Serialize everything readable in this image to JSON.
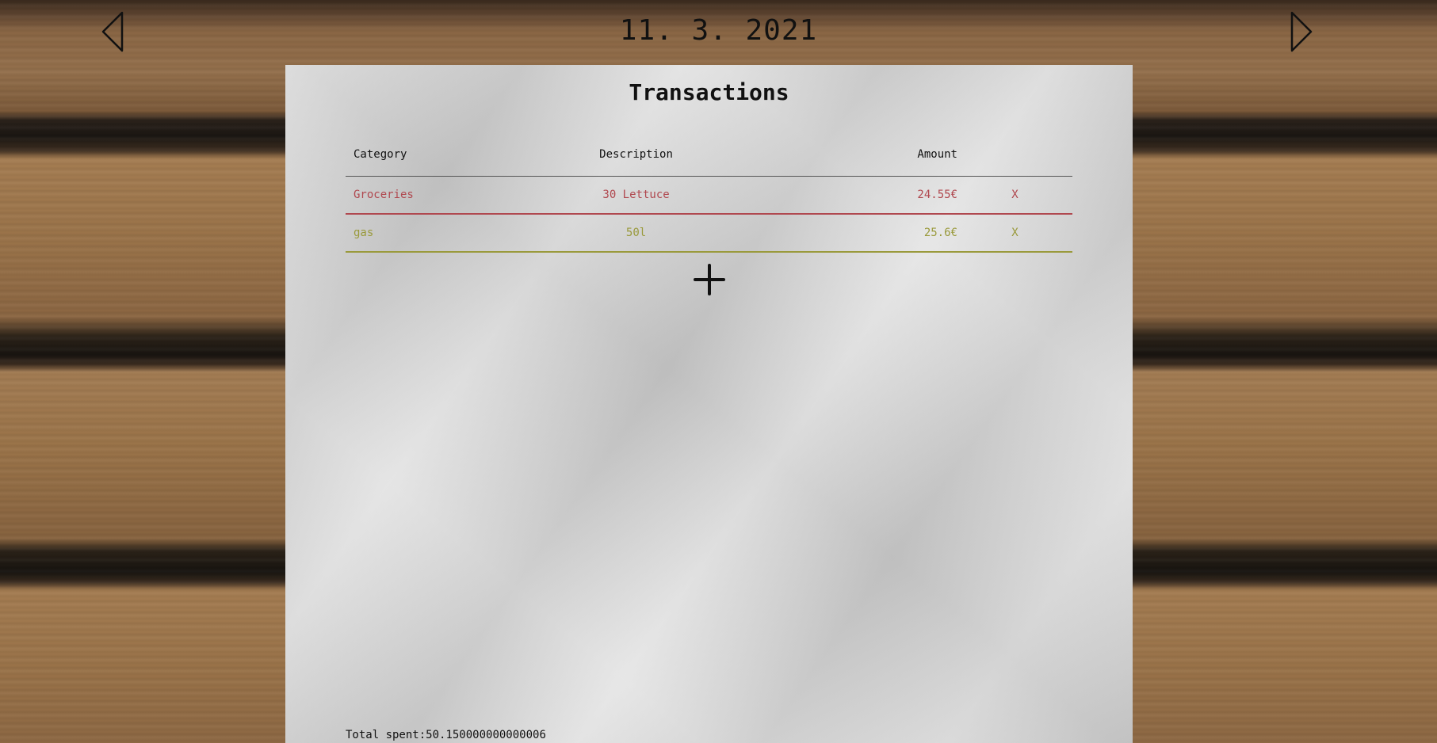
{
  "header": {
    "date": "11. 3. 2021",
    "prev_icon": "triangle-left-outline-icon",
    "next_icon": "triangle-right-outline-icon"
  },
  "paper": {
    "title": "Transactions",
    "columns": {
      "category": "Category",
      "description": "Description",
      "amount": "Amount"
    },
    "rows": [
      {
        "category": "Groceries",
        "description": "30 Lettuce",
        "amount": "24.55€",
        "delete": "X",
        "color": "#b0484f"
      },
      {
        "category": "gas",
        "description": "50l",
        "amount": "25.6€",
        "delete": "X",
        "color": "#9a9a3c"
      }
    ],
    "add_icon": "plus-icon",
    "total_label": "Total spent:",
    "total_value": "50.150000000000006"
  }
}
